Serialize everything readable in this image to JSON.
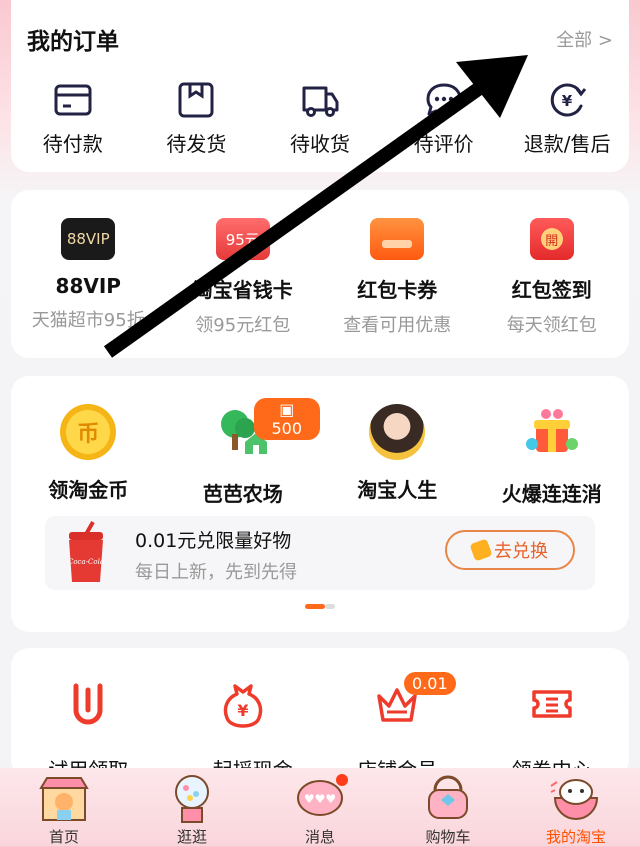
{
  "orders": {
    "title": "我的订单",
    "all_label": "全部 >",
    "items": [
      {
        "label": "待付款",
        "icon": "wallet-icon"
      },
      {
        "label": "待发货",
        "icon": "package-icon"
      },
      {
        "label": "待收货",
        "icon": "truck-icon"
      },
      {
        "label": "待评价",
        "icon": "chat-icon"
      },
      {
        "label": "退款/售后",
        "icon": "refund-icon"
      }
    ]
  },
  "vip": {
    "items": [
      {
        "badge": "88VIP",
        "title": "88VIP",
        "subtitle": "天猫超市95折"
      },
      {
        "badge": "95元",
        "title": "淘宝省钱卡",
        "subtitle": "领95元红包"
      },
      {
        "badge": "",
        "title": "红包卡券",
        "subtitle": "查看可用优惠"
      },
      {
        "badge": "開",
        "title": "红包签到",
        "subtitle": "每天领红包"
      }
    ]
  },
  "fun": {
    "items": [
      {
        "label": "领淘金币",
        "icon_text": "币"
      },
      {
        "label": "芭芭农场",
        "badge": "500"
      },
      {
        "label": "淘宝人生"
      },
      {
        "label": "火爆连连消"
      }
    ],
    "promo": {
      "title": "0.01元兑限量好物",
      "subtitle": "每日上新，先到先得",
      "button": "去兑换",
      "cup_text": "Coca-Cola"
    }
  },
  "services": {
    "items": [
      {
        "label": "试用领取",
        "icon": "trial-icon"
      },
      {
        "label": "一起摇现金",
        "icon": "money-bag-icon",
        "icon_text": "¥"
      },
      {
        "label": "店铺会员",
        "icon": "crown-icon",
        "badge": "0.01"
      },
      {
        "label": "领券中心",
        "icon": "coupon-icon"
      }
    ]
  },
  "tabbar": {
    "items": [
      {
        "label": "首页"
      },
      {
        "label": "逛逛"
      },
      {
        "label": "消息"
      },
      {
        "label": "购物车"
      },
      {
        "label": "我的淘宝"
      }
    ]
  },
  "colors": {
    "accent": "#ff5000",
    "icon_stroke": "#222244",
    "red": "#ee3b2b"
  }
}
